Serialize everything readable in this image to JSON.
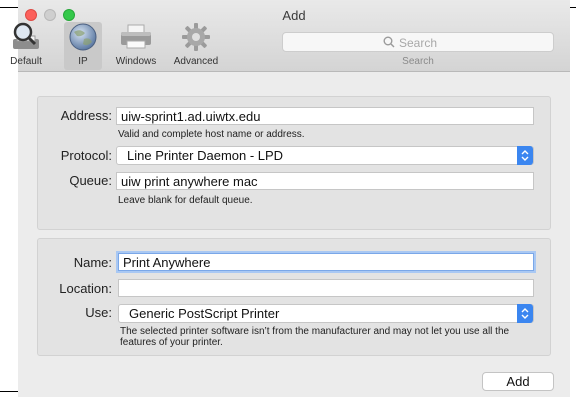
{
  "window": {
    "title": "Add"
  },
  "toolbar": {
    "items": [
      {
        "label": "Default",
        "icon": "magnifier-printer-icon"
      },
      {
        "label": "IP",
        "icon": "globe-icon",
        "selected": true
      },
      {
        "label": "Windows",
        "icon": "printer-icon"
      },
      {
        "label": "Advanced",
        "icon": "gear-icon"
      }
    ],
    "search_placeholder": "Search",
    "search_label": "Search"
  },
  "connection": {
    "address_label": "Address:",
    "address_value": "uiw-sprint1.ad.uiwtx.edu",
    "address_hint": "Valid and complete host name or address.",
    "protocol_label": "Protocol:",
    "protocol_value": "Line Printer Daemon - LPD",
    "queue_label": "Queue:",
    "queue_value": "uiw print anywhere mac",
    "queue_hint": "Leave blank for default queue."
  },
  "printer": {
    "name_label": "Name:",
    "name_value": "Print Anywhere",
    "location_label": "Location:",
    "location_value": "",
    "use_label": "Use:",
    "use_value": "Generic PostScript Printer",
    "use_hint": "The selected printer software isn’t from the manufacturer and may not let you use all the features of your printer."
  },
  "actions": {
    "add_label": "Add"
  },
  "colors": {
    "accent": "#3b86f0",
    "close": "#fc605b",
    "zoom": "#34c84a"
  }
}
